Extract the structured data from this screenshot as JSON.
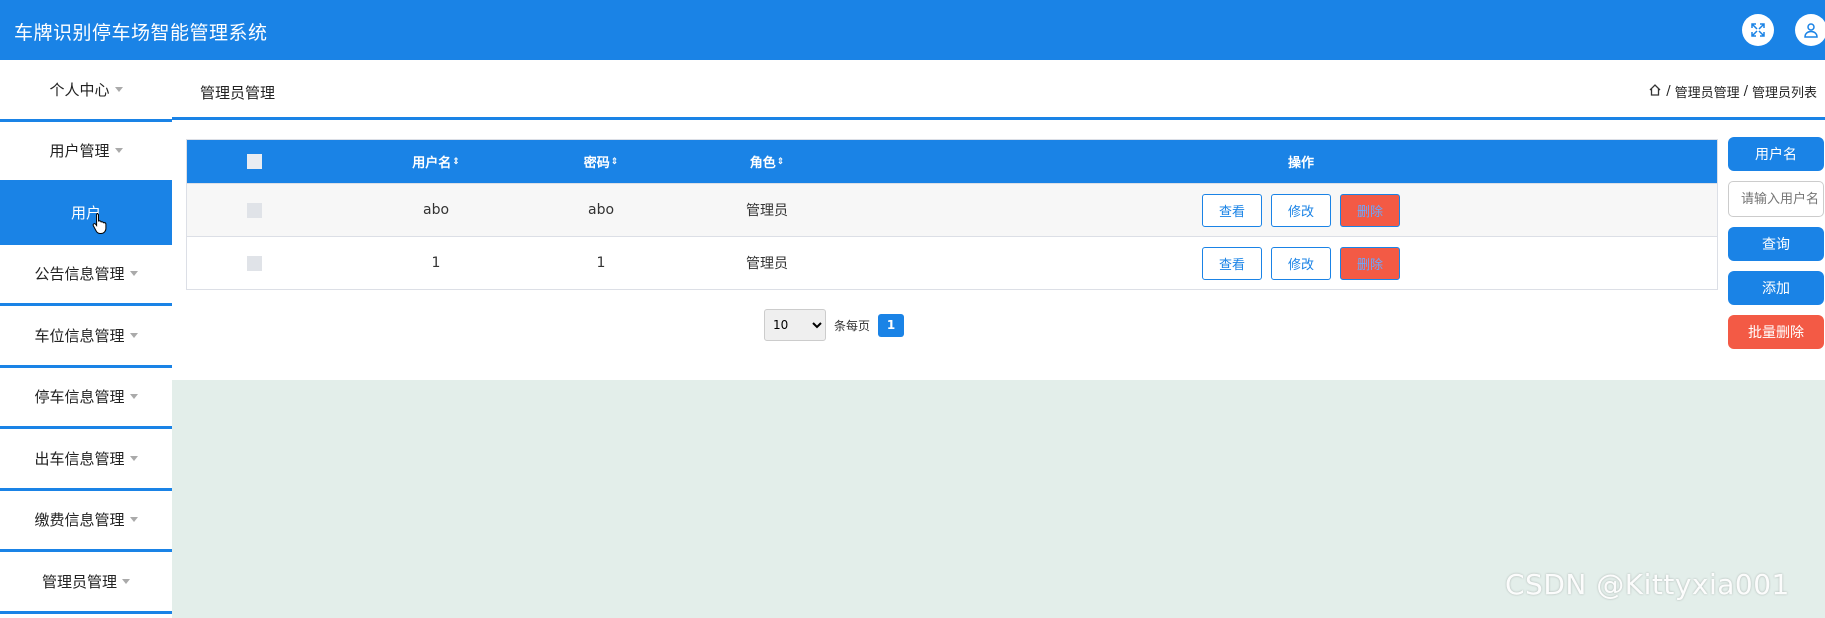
{
  "app": {
    "title": "车牌识别停车场智能管理系统"
  },
  "header_icons": [
    "fullscreen-icon",
    "user-icon"
  ],
  "sidebar": {
    "items": [
      {
        "label": "个人中心",
        "has_caret": true,
        "active": false
      },
      {
        "label": "用户管理",
        "has_caret": true,
        "active": false
      },
      {
        "label": "用户",
        "has_caret": false,
        "active": true
      },
      {
        "label": "公告信息管理",
        "has_caret": true,
        "active": false
      },
      {
        "label": "车位信息管理",
        "has_caret": true,
        "active": false
      },
      {
        "label": "停车信息管理",
        "has_caret": true,
        "active": false
      },
      {
        "label": "出车信息管理",
        "has_caret": true,
        "active": false
      },
      {
        "label": "缴费信息管理",
        "has_caret": true,
        "active": false
      },
      {
        "label": "管理员管理",
        "has_caret": true,
        "active": false
      }
    ]
  },
  "breadcrumb": {
    "page_title": "管理员管理",
    "trail": [
      "管理员管理",
      "管理员列表"
    ],
    "separator": "/"
  },
  "table": {
    "columns": [
      {
        "label": "用户名",
        "sortable": true
      },
      {
        "label": "密码",
        "sortable": true
      },
      {
        "label": "角色",
        "sortable": true
      },
      {
        "label": "操作",
        "sortable": false
      }
    ],
    "sort_glyph": "⇕",
    "rows": [
      {
        "username": "abo",
        "password": "abo",
        "role": "管理员"
      },
      {
        "username": "1",
        "password": "1",
        "role": "管理员"
      }
    ],
    "actions": {
      "view": "查看",
      "edit": "修改",
      "delete": "删除"
    }
  },
  "pagination": {
    "page_size": "10",
    "page_size_options": [
      "10"
    ],
    "per_page_label": "条每页",
    "current_page": "1"
  },
  "search_panel": {
    "field_label": "用户名",
    "placeholder": "请输入用户名",
    "query_button": "查询",
    "add_button": "添加",
    "batch_delete_button": "批量删除"
  },
  "watermark": "CSDN @Kittyxia001",
  "colors": {
    "primary": "#1a83e6",
    "danger": "#f35a45",
    "content_bg": "#e3eeea"
  }
}
